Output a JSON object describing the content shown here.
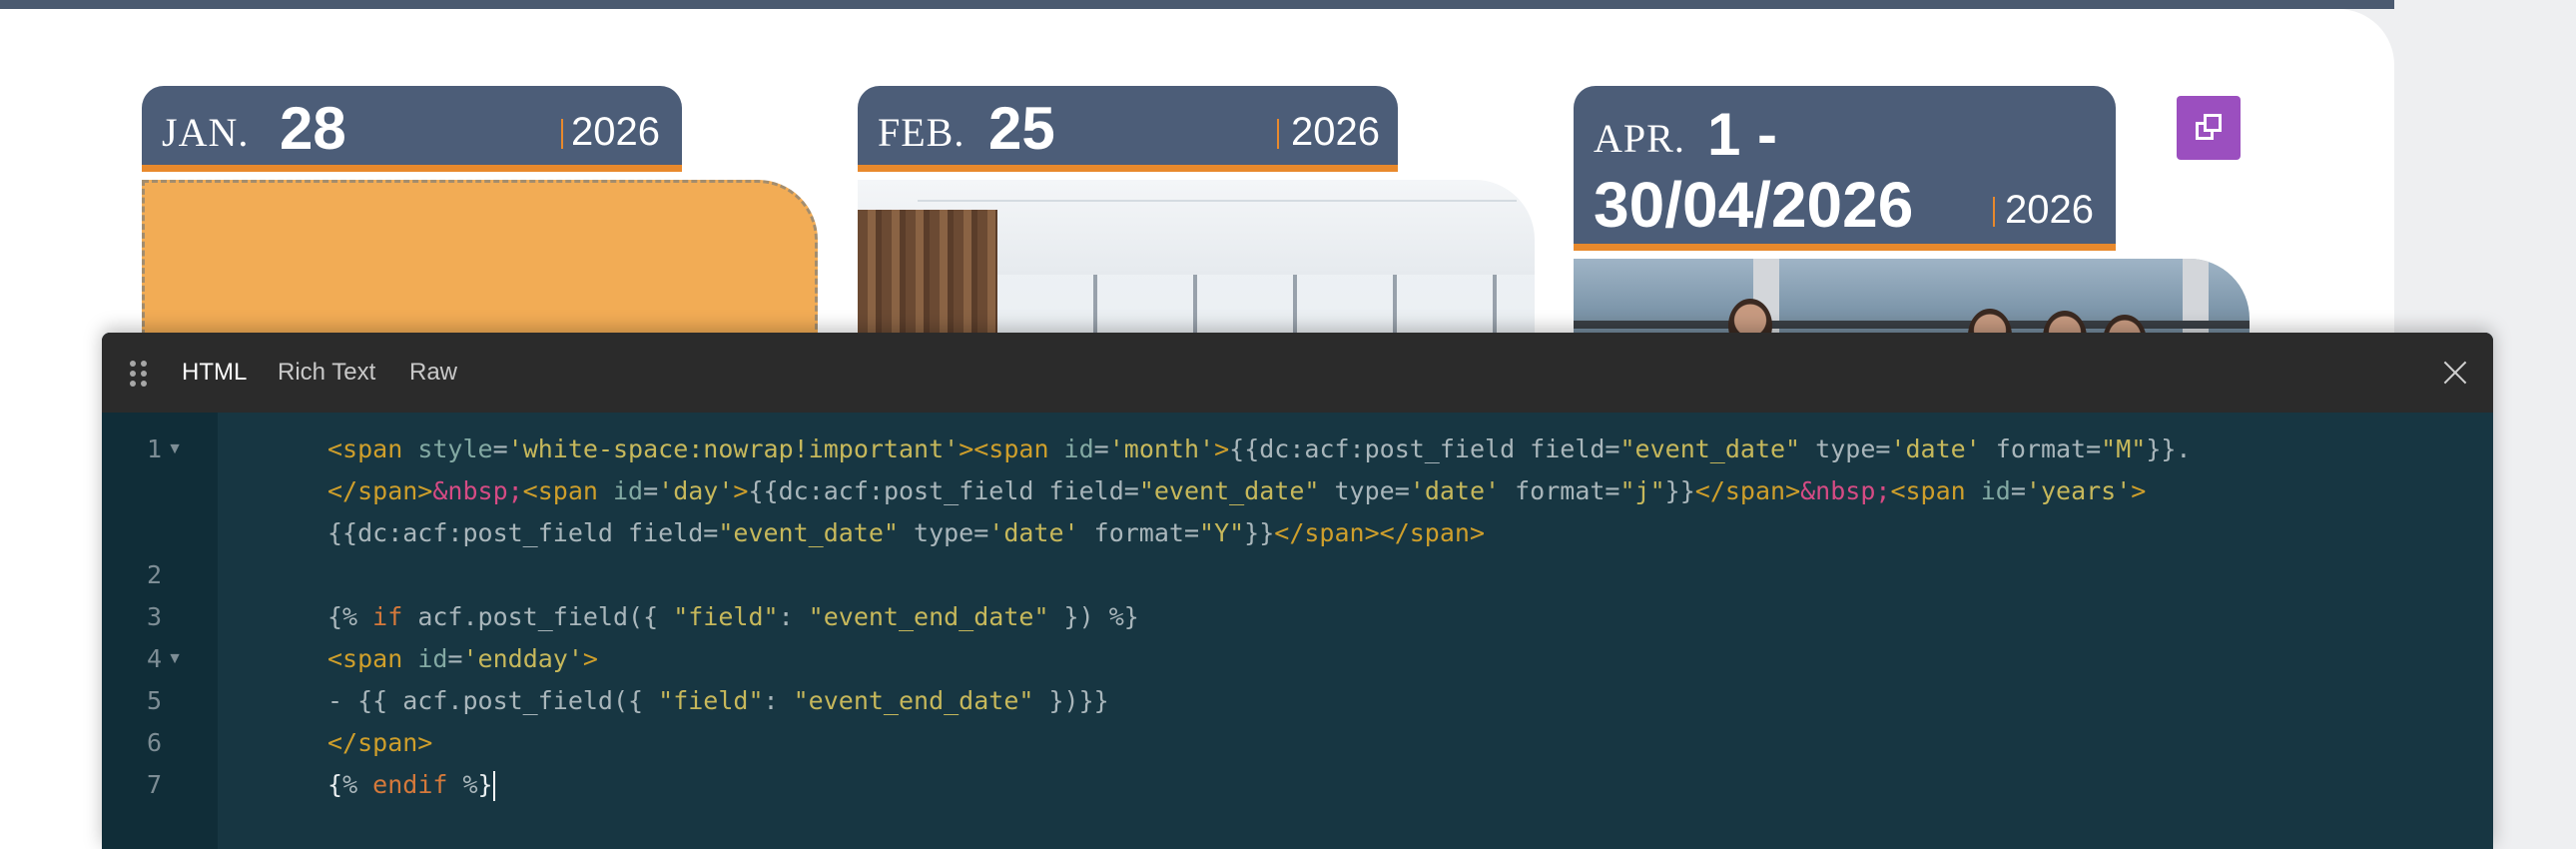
{
  "events": [
    {
      "month": "JAN.",
      "day": "28",
      "year": "2026"
    },
    {
      "month": "FEB.",
      "day": "25",
      "year": "2026"
    },
    {
      "month": "APR.",
      "day": "1 -",
      "day_end": "30/04/2026",
      "year": "2026"
    }
  ],
  "editor": {
    "tabs": [
      "HTML",
      "Rich Text",
      "Raw"
    ],
    "active_tab": "HTML",
    "line_numbers": [
      "1",
      "2",
      "3",
      "4",
      "5",
      "6",
      "7"
    ],
    "code": {
      "l1a": {
        "t1": "<span ",
        "a1": "style",
        "e1": "=",
        "s1": "'white-space:nowrap!important'",
        "t2": "><span ",
        "a2": "id",
        "e2": "=",
        "s2": "'month'",
        "t3": ">",
        "p1": "{{dc:acf:post_field field=",
        "s3": "\"event_date\"",
        "p2": " type=",
        "s4": "'date'",
        "p3": " format=",
        "s5": "\"M\"",
        "p4": "}}."
      },
      "l1b": {
        "t1": "</span>",
        "n1": "&nbsp;",
        "t2": "<span ",
        "a1": "id",
        "e1": "=",
        "s1": "'day'",
        "t3": ">",
        "p1": "{{dc:acf:post_field field=",
        "s2": "\"event_date\"",
        "p2": " type=",
        "s3": "'date'",
        "p3": " format=",
        "s4": "\"j\"",
        "p4": "}}",
        "t4": "</span>",
        "n2": "&nbsp;",
        "t5": "<span ",
        "a2": "id",
        "e2": "=",
        "s5": "'years'",
        "t6": ">"
      },
      "l1c": {
        "p1": "{{dc:acf:post_field field=",
        "s1": "\"event_date\"",
        "p2": " type=",
        "s2": "'date'",
        "p3": " format=",
        "s3": "\"Y\"",
        "p4": "}}",
        "t1": "</span></span>"
      },
      "l3": {
        "p1": "{% ",
        "k1": "if",
        "p2": " acf.post_field({ ",
        "s1": "\"field\"",
        "p3": ": ",
        "s2": "\"event_end_date\"",
        "p4": " }) %}"
      },
      "l4": {
        "t1": "<span ",
        "a1": "id",
        "e1": "=",
        "s1": "'endday'",
        "t2": ">"
      },
      "l5": {
        "p1": "- {{ acf.post_field({ ",
        "s1": "\"field\"",
        "p2": ": ",
        "s2": "\"event_end_date\"",
        "p3": " })}}"
      },
      "l6": {
        "t1": "</span>"
      },
      "l7": {
        "p0": "{",
        "p1": "% ",
        "k1": "endif",
        "p2": " %",
        "p3": "}"
      }
    }
  }
}
